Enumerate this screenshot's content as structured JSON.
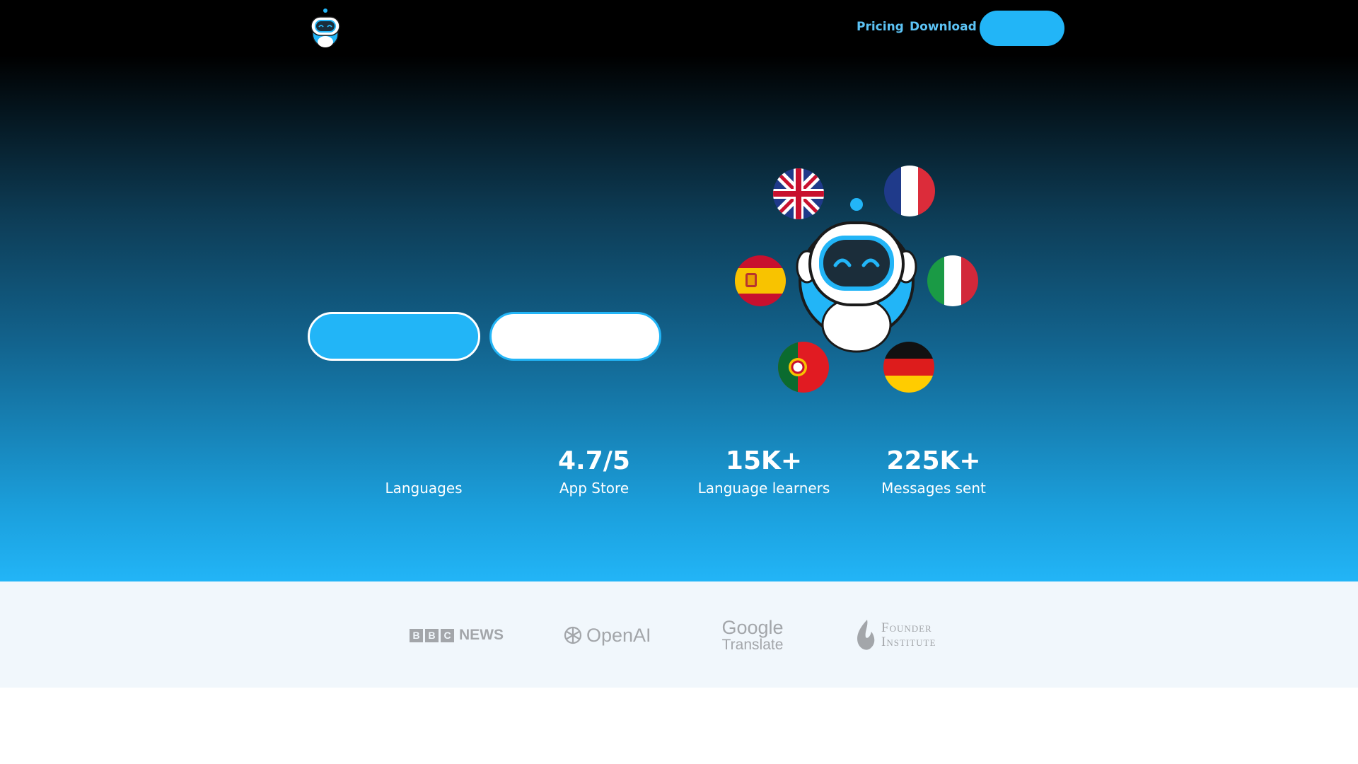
{
  "colors": {
    "accent": "#22b5f7",
    "nav_link": "#5cc3f5",
    "logo_gray": "#a3a6aa",
    "band_bg": "#f1f7fc"
  },
  "nav": {
    "logo_icon": "robot-mascot-icon",
    "links": [
      "Pricing",
      "Download"
    ],
    "cta_label": ""
  },
  "hero": {
    "primary_button_label": "",
    "secondary_button_label": "",
    "mascot_icon": "robot-mascot-icon",
    "flags": [
      "uk-flag-icon",
      "france-flag-icon",
      "spain-flag-icon",
      "italy-flag-icon",
      "portugal-flag-icon",
      "germany-flag-icon"
    ]
  },
  "stats": [
    {
      "value": "",
      "label": "Languages"
    },
    {
      "value": "4.7/5",
      "label": "App Store"
    },
    {
      "value": "15K+",
      "label": "Language learners"
    },
    {
      "value": "225K+",
      "label": "Messages sent"
    }
  ],
  "press": {
    "bbc": {
      "letters": [
        "B",
        "B",
        "C"
      ],
      "word": "NEWS"
    },
    "openai": "OpenAI",
    "google": {
      "top": "Google",
      "bottom": "Translate"
    },
    "founder": {
      "line1": "Founder",
      "line2": "Institute"
    }
  }
}
